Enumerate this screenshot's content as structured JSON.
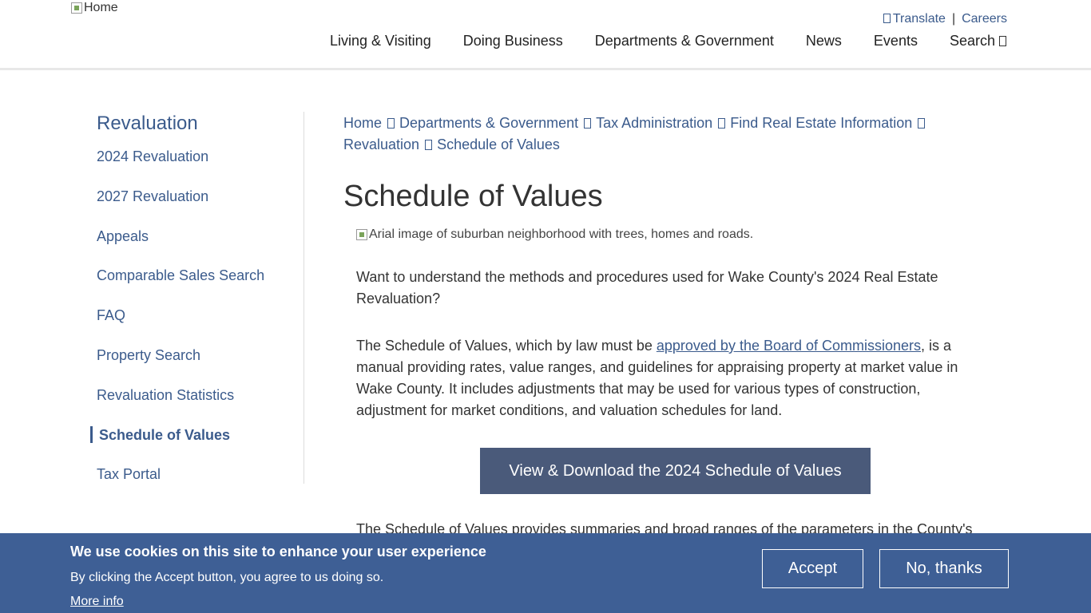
{
  "header": {
    "logo_alt": "Home",
    "utility": {
      "translate": "Translate",
      "separator": "|",
      "careers": "Careers"
    },
    "nav": [
      "Living & Visiting",
      "Doing Business",
      "Departments & Government",
      "News",
      "Events",
      "Search"
    ]
  },
  "sidebar": {
    "title": "Revaluation",
    "items": [
      {
        "label": "2024 Revaluation"
      },
      {
        "label": "2027 Revaluation"
      },
      {
        "label": "Appeals"
      },
      {
        "label": "Comparable Sales Search"
      },
      {
        "label": "FAQ"
      },
      {
        "label": "Property Search"
      },
      {
        "label": "Revaluation Statistics"
      },
      {
        "label": "Schedule of Values"
      },
      {
        "label": "Tax Portal"
      }
    ],
    "active_index": 7
  },
  "breadcrumb": [
    "Home",
    "Departments & Government",
    "Tax Administration",
    "Find Real Estate Information",
    "Revaluation",
    "Schedule of Values"
  ],
  "main": {
    "title": "Schedule of Values",
    "hero_alt": "Arial image of suburban neighborhood with trees, homes and roads.",
    "p1": "Want to understand the methods and procedures used for Wake County's 2024 Real Estate Revaluation?",
    "p2_before": "The Schedule of Values, which by law must be ",
    "p2_link": "approved by the Board of Commissioners",
    "p2_after": ", is a manual providing rates, value ranges, and guidelines for appraising  property at market value in Wake County. It includes adjustments that may be used for various types of construction, adjustment for market conditions, and valuation schedules for land.",
    "cta": "View & Download the 2024 Schedule of Values",
    "p3": "The Schedule of Values provides summaries and broad ranges of the parameters in the County's"
  },
  "cookie": {
    "heading": "We use cookies on this site to enhance your user experience",
    "desc": "By clicking the Accept button, you agree to us doing so.",
    "more": "More info",
    "accept": "Accept",
    "decline": "No, thanks"
  },
  "colors": {
    "link": "#3b5b8c",
    "banner": "#3e5f95",
    "cta": "#4a5a7a"
  }
}
